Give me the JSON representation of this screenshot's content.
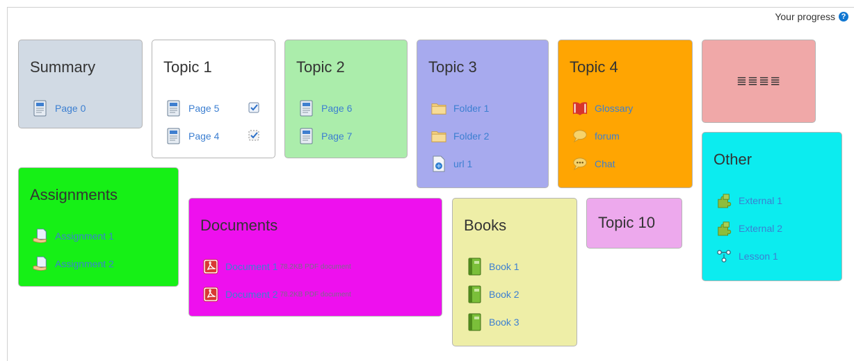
{
  "progress_label": "Your progress",
  "colors": {
    "summary": "#d1dae4",
    "topic1": "#ffffff",
    "topic2": "#abedab",
    "topic3": "#a7aaee",
    "topic4": "#ffa502",
    "format_tile": "#f0a8a8",
    "other": "#0cecef",
    "assignments": "#16f016",
    "documents": "#ee10ee",
    "books": "#eeeea7",
    "topic10": "#eda9ed",
    "link": "#3c7fd1"
  },
  "tiles": {
    "summary": {
      "title": "Summary",
      "items": [
        {
          "label": "Page 0",
          "icon": "page-icon"
        }
      ]
    },
    "topic1": {
      "title": "Topic 1",
      "items": [
        {
          "label": "Page 5",
          "icon": "page-icon",
          "status": "completed-checkbox"
        },
        {
          "label": "Page 4",
          "icon": "page-icon",
          "status": "manual-checkbox"
        }
      ]
    },
    "topic2": {
      "title": "Topic 2",
      "items": [
        {
          "label": "Page 6",
          "icon": "page-icon"
        },
        {
          "label": "Page 7",
          "icon": "page-icon"
        }
      ]
    },
    "topic3": {
      "title": "Topic 3",
      "items": [
        {
          "label": "Folder 1",
          "icon": "folder-icon"
        },
        {
          "label": "Folder 2",
          "icon": "folder-icon"
        },
        {
          "label": "url 1",
          "icon": "url-icon"
        }
      ]
    },
    "topic4": {
      "title": "Topic 4",
      "items": [
        {
          "label": "Glossary",
          "icon": "glossary-icon"
        },
        {
          "label": "forum",
          "icon": "forum-icon"
        },
        {
          "label": "Chat",
          "icon": "chat-icon"
        }
      ]
    },
    "format": {
      "glyphs": "≣≣≣≣",
      "icon": "alignment-icons"
    },
    "other": {
      "title": "Other",
      "items": [
        {
          "label": "External 1",
          "icon": "external-tool-icon"
        },
        {
          "label": "External 2",
          "icon": "external-tool-icon"
        },
        {
          "label": "Lesson 1",
          "icon": "lesson-icon"
        }
      ]
    },
    "assignments": {
      "title": "Assignments",
      "items": [
        {
          "label": "Assignment 1",
          "icon": "assignment-icon"
        },
        {
          "label": "Assignment 2",
          "icon": "assignment-icon"
        }
      ]
    },
    "documents": {
      "title": "Documents",
      "items": [
        {
          "label": "Document 1",
          "meta": "78.2KB PDF document",
          "icon": "pdf-icon"
        },
        {
          "label": "Document 2",
          "meta": "78.2KB PDF document",
          "icon": "pdf-icon"
        }
      ]
    },
    "books": {
      "title": "Books",
      "items": [
        {
          "label": "Book 1",
          "icon": "book-icon"
        },
        {
          "label": "Book 2",
          "icon": "book-icon"
        },
        {
          "label": "Book 3",
          "icon": "book-icon"
        }
      ]
    },
    "topic10": {
      "title": "Topic 10"
    }
  }
}
